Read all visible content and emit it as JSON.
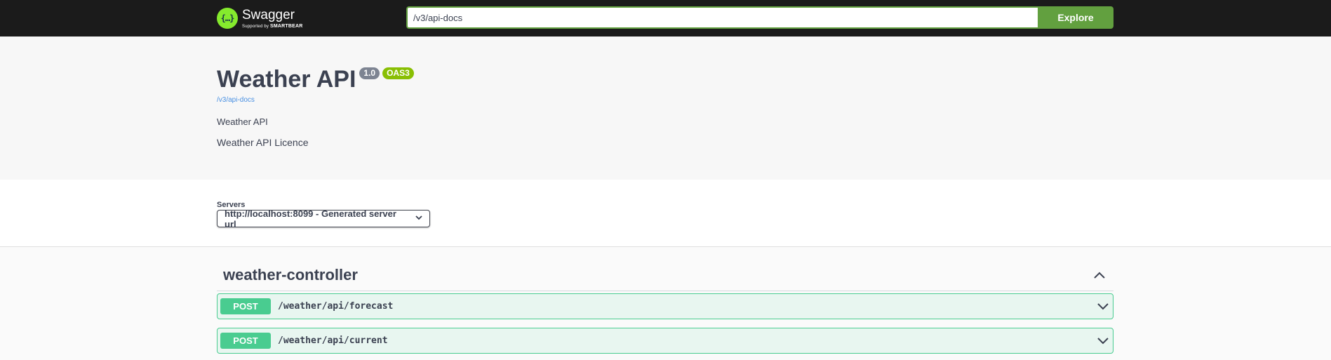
{
  "topbar": {
    "logo_name": "Swagger",
    "logo_sub_prefix": "Supported by",
    "logo_sub_brand": "SMARTBEAR",
    "url_value": "/v3/api-docs",
    "explore_label": "Explore"
  },
  "info": {
    "title": "Weather API",
    "version_badge": "1.0",
    "oas_badge": "OAS3",
    "spec_link": "/v3/api-docs",
    "description": "Weather API",
    "licence": "Weather API Licence"
  },
  "servers": {
    "label": "Servers",
    "selected": "http://localhost:8099 - Generated server url"
  },
  "tag": {
    "name": "weather-controller",
    "expanded": true
  },
  "operations": [
    {
      "method": "POST",
      "path": "/weather/api/forecast"
    },
    {
      "method": "POST",
      "path": "/weather/api/current"
    }
  ],
  "colors": {
    "topbar_bg": "#1b1b1b",
    "accent_green": "#62a03f",
    "post_green": "#49cc90",
    "oas_badge": "#89bf04",
    "version_badge": "#7d8492",
    "link_blue": "#4990e2"
  },
  "icons": {
    "logo": "swagger-logo-icon",
    "server_dropdown": "chevron-down-icon",
    "tag_toggle": "chevron-up-icon",
    "operation_toggle": "chevron-down-icon"
  }
}
